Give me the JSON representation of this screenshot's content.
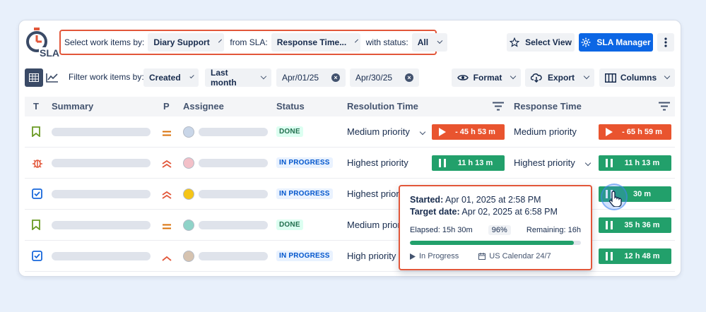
{
  "logo": {
    "text": "SLA"
  },
  "filters": {
    "select_label": "Select work items by:",
    "select_value": "Diary Support",
    "sla_label": "from SLA:",
    "sla_value": "Response Time...",
    "status_label": "with status:",
    "status_value": "All"
  },
  "toolbar": {
    "select_view": "Select View",
    "sla_manager": "SLA Manager",
    "filter_label": "Filter work items by:",
    "created": "Created",
    "range": "Last month",
    "date_from": "Apr/01/25",
    "date_to": "Apr/30/25",
    "format": "Format",
    "export": "Export",
    "columns": "Columns",
    "clear_icon": "×"
  },
  "columns": {
    "type": "T",
    "summary": "Summary",
    "priority": "P",
    "assignee": "Assignee",
    "status": "Status",
    "resolution": "Resolution Time",
    "response": "Response Time"
  },
  "rows": [
    {
      "type_icon": "bookmark-icon",
      "priority_icon": "priority-medium-icon",
      "status": "DONE",
      "status_kind": "done",
      "resolution_priority": "Medium priority",
      "resolution_timer": "- 45 h 53 m",
      "resolution_state": "overdue",
      "response_priority": "Medium priority",
      "response_timer": "- 65 h 59 m",
      "response_state": "overdue"
    },
    {
      "type_icon": "bug-icon",
      "priority_icon": "priority-highest-icon",
      "status": "IN PROGRESS",
      "status_kind": "progress",
      "resolution_priority": "Highest priority",
      "resolution_timer": "11 h 13 m",
      "resolution_state": "paused",
      "response_priority": "Highest priority",
      "response_timer": "11 h 13 m",
      "response_state": "paused"
    },
    {
      "type_icon": "checkbox-icon",
      "priority_icon": "priority-highest-icon",
      "status": "IN PROGRESS",
      "status_kind": "progress",
      "resolution_priority": "Highest priority",
      "resolution_timer": "",
      "resolution_state": "",
      "response_priority": "",
      "response_timer": "30 m",
      "response_state": "paused"
    },
    {
      "type_icon": "bookmark-icon",
      "priority_icon": "priority-medium-icon",
      "status": "DONE",
      "status_kind": "done",
      "resolution_priority": "Medium priority",
      "resolution_timer": "",
      "resolution_state": "",
      "response_priority": "",
      "response_timer": "35 h 36 m",
      "response_state": "paused"
    },
    {
      "type_icon": "checkbox-icon",
      "priority_icon": "priority-high-icon",
      "status": "IN PROGRESS",
      "status_kind": "progress",
      "resolution_priority": "High priority",
      "resolution_timer": "",
      "resolution_state": "",
      "response_priority": "",
      "response_timer": "12 h 48 m",
      "response_state": "paused"
    }
  ],
  "tooltip": {
    "started_label": "Started:",
    "started_value": "Apr 01, 2025 at 2:58 PM",
    "target_label": "Target date:",
    "target_value": "Apr 02, 2025 at 6:58 PM",
    "elapsed": "Elapsed: 15h 30m",
    "percent": "96%",
    "percent_value": 0.96,
    "remaining": "Remaining: 16h",
    "state": "In Progress",
    "calendar": "US Calendar 24/7"
  },
  "colors": {
    "accent": "#0c66e4",
    "overdue": "#e9542f",
    "ok": "#22a06b",
    "highlight_border": "#e2573a"
  }
}
